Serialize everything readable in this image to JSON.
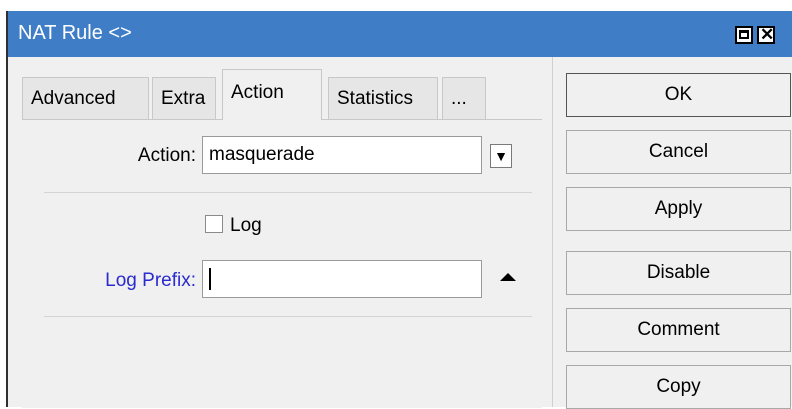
{
  "window": {
    "title": "NAT Rule <>"
  },
  "titlebar_buttons": {
    "maximize_icon": "maximize-icon",
    "close_label": "✕"
  },
  "tabs": [
    {
      "label": "Advanced",
      "active": false
    },
    {
      "label": "Extra",
      "active": false
    },
    {
      "label": "Action",
      "active": true
    },
    {
      "label": "Statistics",
      "active": false
    },
    {
      "label": "...",
      "active": false
    }
  ],
  "form": {
    "action_label": "Action:",
    "action_value": "masquerade",
    "log_label": "Log",
    "log_checked": false,
    "log_prefix_label": "Log Prefix:",
    "log_prefix_value": "",
    "label_accent_color": "#2a2ad0"
  },
  "buttons": [
    "OK",
    "Cancel",
    "Apply",
    "Disable",
    "Comment",
    "Copy"
  ]
}
